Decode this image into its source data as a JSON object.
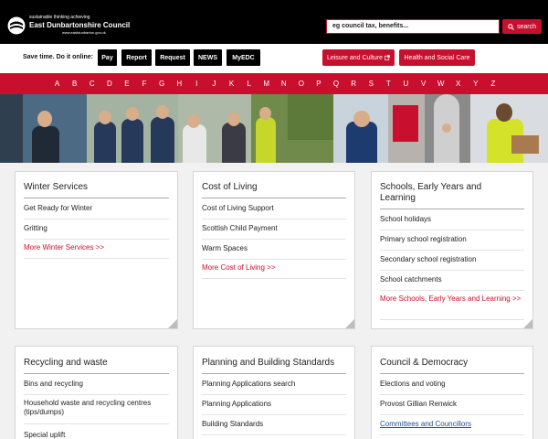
{
  "header": {
    "tagline": "sustainable thinking achieving",
    "council_name": "East Dunbartonshire Council",
    "url": "www.eastdunbarton.gov.uk",
    "search_placeholder": "eg council tax, benefits...",
    "search_label": "search"
  },
  "topbar": {
    "save_label": "Save time. Do it online:",
    "quick": [
      "Pay",
      "Report",
      "Request",
      "NEWS",
      "MyEDC"
    ],
    "red": [
      "Leisure and Culture",
      "Health and Social Care"
    ]
  },
  "az": [
    "A",
    "B",
    "C",
    "D",
    "E",
    "F",
    "G",
    "H",
    "I",
    "J",
    "K",
    "L",
    "M",
    "N",
    "O",
    "P",
    "Q",
    "R",
    "S",
    "T",
    "U",
    "V",
    "W",
    "X",
    "Y",
    "Z"
  ],
  "colors": {
    "brand_red": "#c8102e",
    "header_black": "#000000"
  },
  "cards": [
    {
      "title": "Winter Services",
      "items": [
        "Get Ready for Winter",
        "Gritting"
      ],
      "more": "More Winter Services >>"
    },
    {
      "title": "Cost of Living",
      "items": [
        "Cost of Living Support",
        "Scottish Child Payment",
        "Warm Spaces"
      ],
      "more": "More Cost of Living >>"
    },
    {
      "title": "Schools, Early Years and Learning",
      "items": [
        "School holidays",
        "Primary school registration",
        "Secondary school registration",
        "School catchments"
      ],
      "more": "More Schools, Early Years and Learning >>"
    },
    {
      "title": "Recycling and waste",
      "items": [
        "Bins and recycling",
        "Household waste and recycling centres (tips/dumps)",
        "Special uplift"
      ]
    },
    {
      "title": "Planning and Building Standards",
      "items": [
        "Planning Applications search",
        "Planning Applications",
        "Building Standards"
      ]
    },
    {
      "title": "Council & Democracy",
      "items": [
        "Elections and voting",
        "Provost Gillian Renwick"
      ],
      "link": "Committees and Councillors"
    }
  ]
}
